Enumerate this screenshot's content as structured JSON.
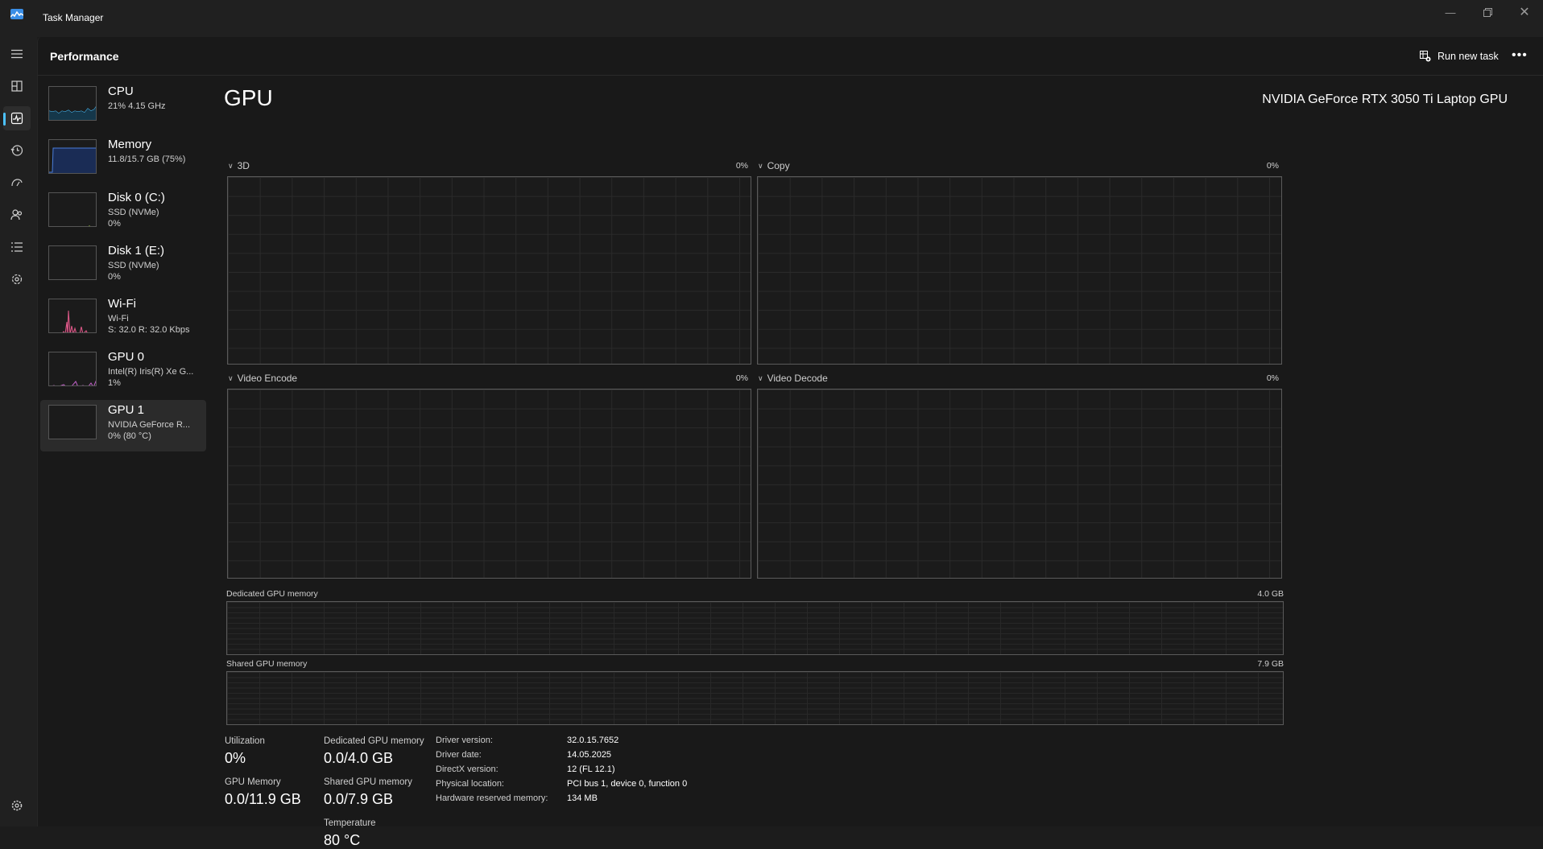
{
  "window": {
    "title": "Task Manager"
  },
  "header": {
    "title": "Performance",
    "run_task_label": "Run new task"
  },
  "sidebar": {
    "items": [
      {
        "name": "CPU",
        "line1": "21%  4.15 GHz",
        "line2": "",
        "color": "#4cc2ff"
      },
      {
        "name": "Memory",
        "line1": "11.8/15.7 GB (75%)",
        "line2": "",
        "color": "#4a7dd8"
      },
      {
        "name": "Disk 0 (C:)",
        "line1": "SSD (NVMe)",
        "line2": "0%",
        "color": "#8fbf3a"
      },
      {
        "name": "Disk 1 (E:)",
        "line1": "SSD (NVMe)",
        "line2": "0%",
        "color": "#8fbf3a"
      },
      {
        "name": "Wi-Fi",
        "line1": "Wi-Fi",
        "line2": "S: 32.0  R: 32.0 Kbps",
        "color": "#e05a8a"
      },
      {
        "name": "GPU 0",
        "line1": "Intel(R) Iris(R) Xe G...",
        "line2": "1%",
        "color": "#c060c8"
      },
      {
        "name": "GPU 1",
        "line1": "NVIDIA GeForce R...",
        "line2": "0%  (80 °C)",
        "color": "#c060c8"
      }
    ]
  },
  "gpu": {
    "title": "GPU",
    "model": "NVIDIA GeForce RTX 3050 Ti Laptop GPU",
    "engines": [
      {
        "label": "3D",
        "percent": "0%"
      },
      {
        "label": "Copy",
        "percent": "0%"
      },
      {
        "label": "Video Encode",
        "percent": "0%"
      },
      {
        "label": "Video Decode",
        "percent": "0%"
      }
    ],
    "dedicated_memory": {
      "label": "Dedicated GPU memory",
      "max": "4.0 GB"
    },
    "shared_memory": {
      "label": "Shared GPU memory",
      "max": "7.9 GB"
    }
  },
  "stats": {
    "utilization": {
      "label": "Utilization",
      "value": "0%"
    },
    "dedicated": {
      "label": "Dedicated GPU memory",
      "value": "0.0/4.0 GB"
    },
    "gpu_memory": {
      "label": "GPU Memory",
      "value": "0.0/11.9 GB"
    },
    "shared": {
      "label": "Shared GPU memory",
      "value": "0.0/7.9 GB"
    },
    "temperature": {
      "label": "Temperature",
      "value": "80 °C"
    }
  },
  "info": [
    {
      "key": "Driver version:",
      "value": "32.0.15.7652"
    },
    {
      "key": "Driver date:",
      "value": "14.05.2025"
    },
    {
      "key": "DirectX version:",
      "value": "12 (FL 12.1)"
    },
    {
      "key": "Physical location:",
      "value": "PCI bus 1, device 0, function 0"
    },
    {
      "key": "Hardware reserved memory:",
      "value": "134 MB"
    }
  ],
  "icons": {
    "rail": [
      "hamburger-icon",
      "processes-icon",
      "performance-icon",
      "app-history-icon",
      "startup-apps-icon",
      "users-icon",
      "details-icon",
      "services-icon",
      "settings-icon"
    ]
  }
}
